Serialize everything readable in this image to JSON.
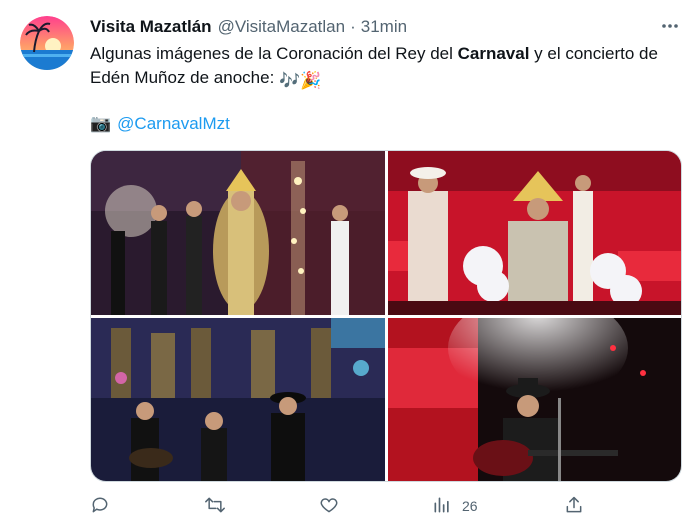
{
  "account": {
    "display_name": "Visita Mazatlán",
    "handle": "@VisitaMazatlan",
    "separator": "·",
    "time": "31min"
  },
  "tweet": {
    "text_part1": "Algunas imágenes de la Coronación del Rey del ",
    "text_bold": "Carnaval",
    "text_part2": " y el concierto de Edén Muñoz de anoche: ",
    "emojis": "🎶🎉",
    "camera_emoji": "📷",
    "mention": "@CarnavalMzt"
  },
  "actions": {
    "reply_count": "",
    "retweet_count": "",
    "like_count": "",
    "views_count": "26"
  },
  "icons": {
    "more": "more-options-icon",
    "reply": "reply-icon",
    "retweet": "retweet-icon",
    "like": "heart-icon",
    "views": "views-chart-icon",
    "share": "share-icon"
  },
  "colors": {
    "text": "#0f1419",
    "secondary": "#536471",
    "link": "#1d9bf0",
    "border": "#cfd9de"
  }
}
